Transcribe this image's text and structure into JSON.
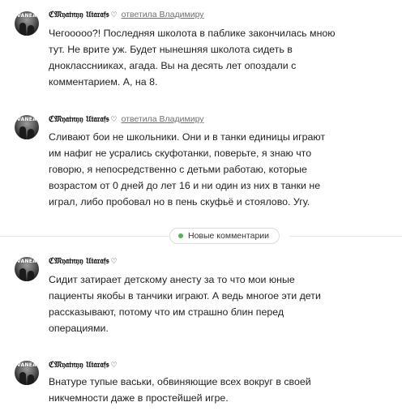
{
  "comments": [
    {
      "author": "ℭ𝔐𝔶𝔞𝔱𝔫𝔶𝔶 𝔘𝔱𝔞𝔯𝔞𝔣𝔰",
      "badge": "♡",
      "reply_to": "ответила Владимиру",
      "lines": [
        "Чегооооо?! Последняя школота в паблике закончилась мною",
        "тут. Не врите уж. Будет нынешняя школота сидеть в",
        "днокласснииках, агада. Вы на десять лет опоздали с",
        "комментарием. А, на 8."
      ]
    },
    {
      "author": "ℭ𝔐𝔶𝔞𝔱𝔫𝔶𝔶 𝔘𝔱𝔞𝔯𝔞𝔣𝔰",
      "badge": "♡",
      "reply_to": "ответила Владимиру",
      "lines": [
        "Сливают бои не школьники. Они и в танки единицы играют",
        "им нафиг не усрались скуфотанки, поверьте, я знаю что",
        "говорю, я непосредственно с детьми работаю, которые",
        "возрастом от 0 дней до лет 16 и ни один из них в танки не",
        "играл, либо пробовал но в пень скуфьё и стоялово. Угу."
      ]
    },
    {
      "author": "ℭ𝔐𝔶𝔞𝔱𝔫𝔶𝔶 𝔘𝔱𝔞𝔯𝔞𝔣𝔰",
      "badge": "♡",
      "reply_to": "",
      "lines": [
        "Сидит затирает детскому анесту за то что мои юные",
        "пациенты якобы в танчики играют. А ведь многое эти дети",
        "рассказывают, потому что им страшно блин перед",
        "операциями."
      ]
    },
    {
      "author": "ℭ𝔐𝔶𝔞𝔱𝔫𝔶𝔶 𝔘𝔱𝔞𝔯𝔞𝔣𝔰",
      "badge": "♡",
      "reply_to": "",
      "lines": [
        "Внатуре тупые васьки, обвиняющие всех вокруг в своей",
        "никчемности даже в простейшей игре."
      ]
    }
  ],
  "divider": {
    "label": "Новые комментарии",
    "dot_color": "#53b84a"
  },
  "avatar": {
    "tag": "VANEA"
  },
  "colors": {
    "text": "#222222",
    "link": "#707070",
    "author": "#111111"
  }
}
